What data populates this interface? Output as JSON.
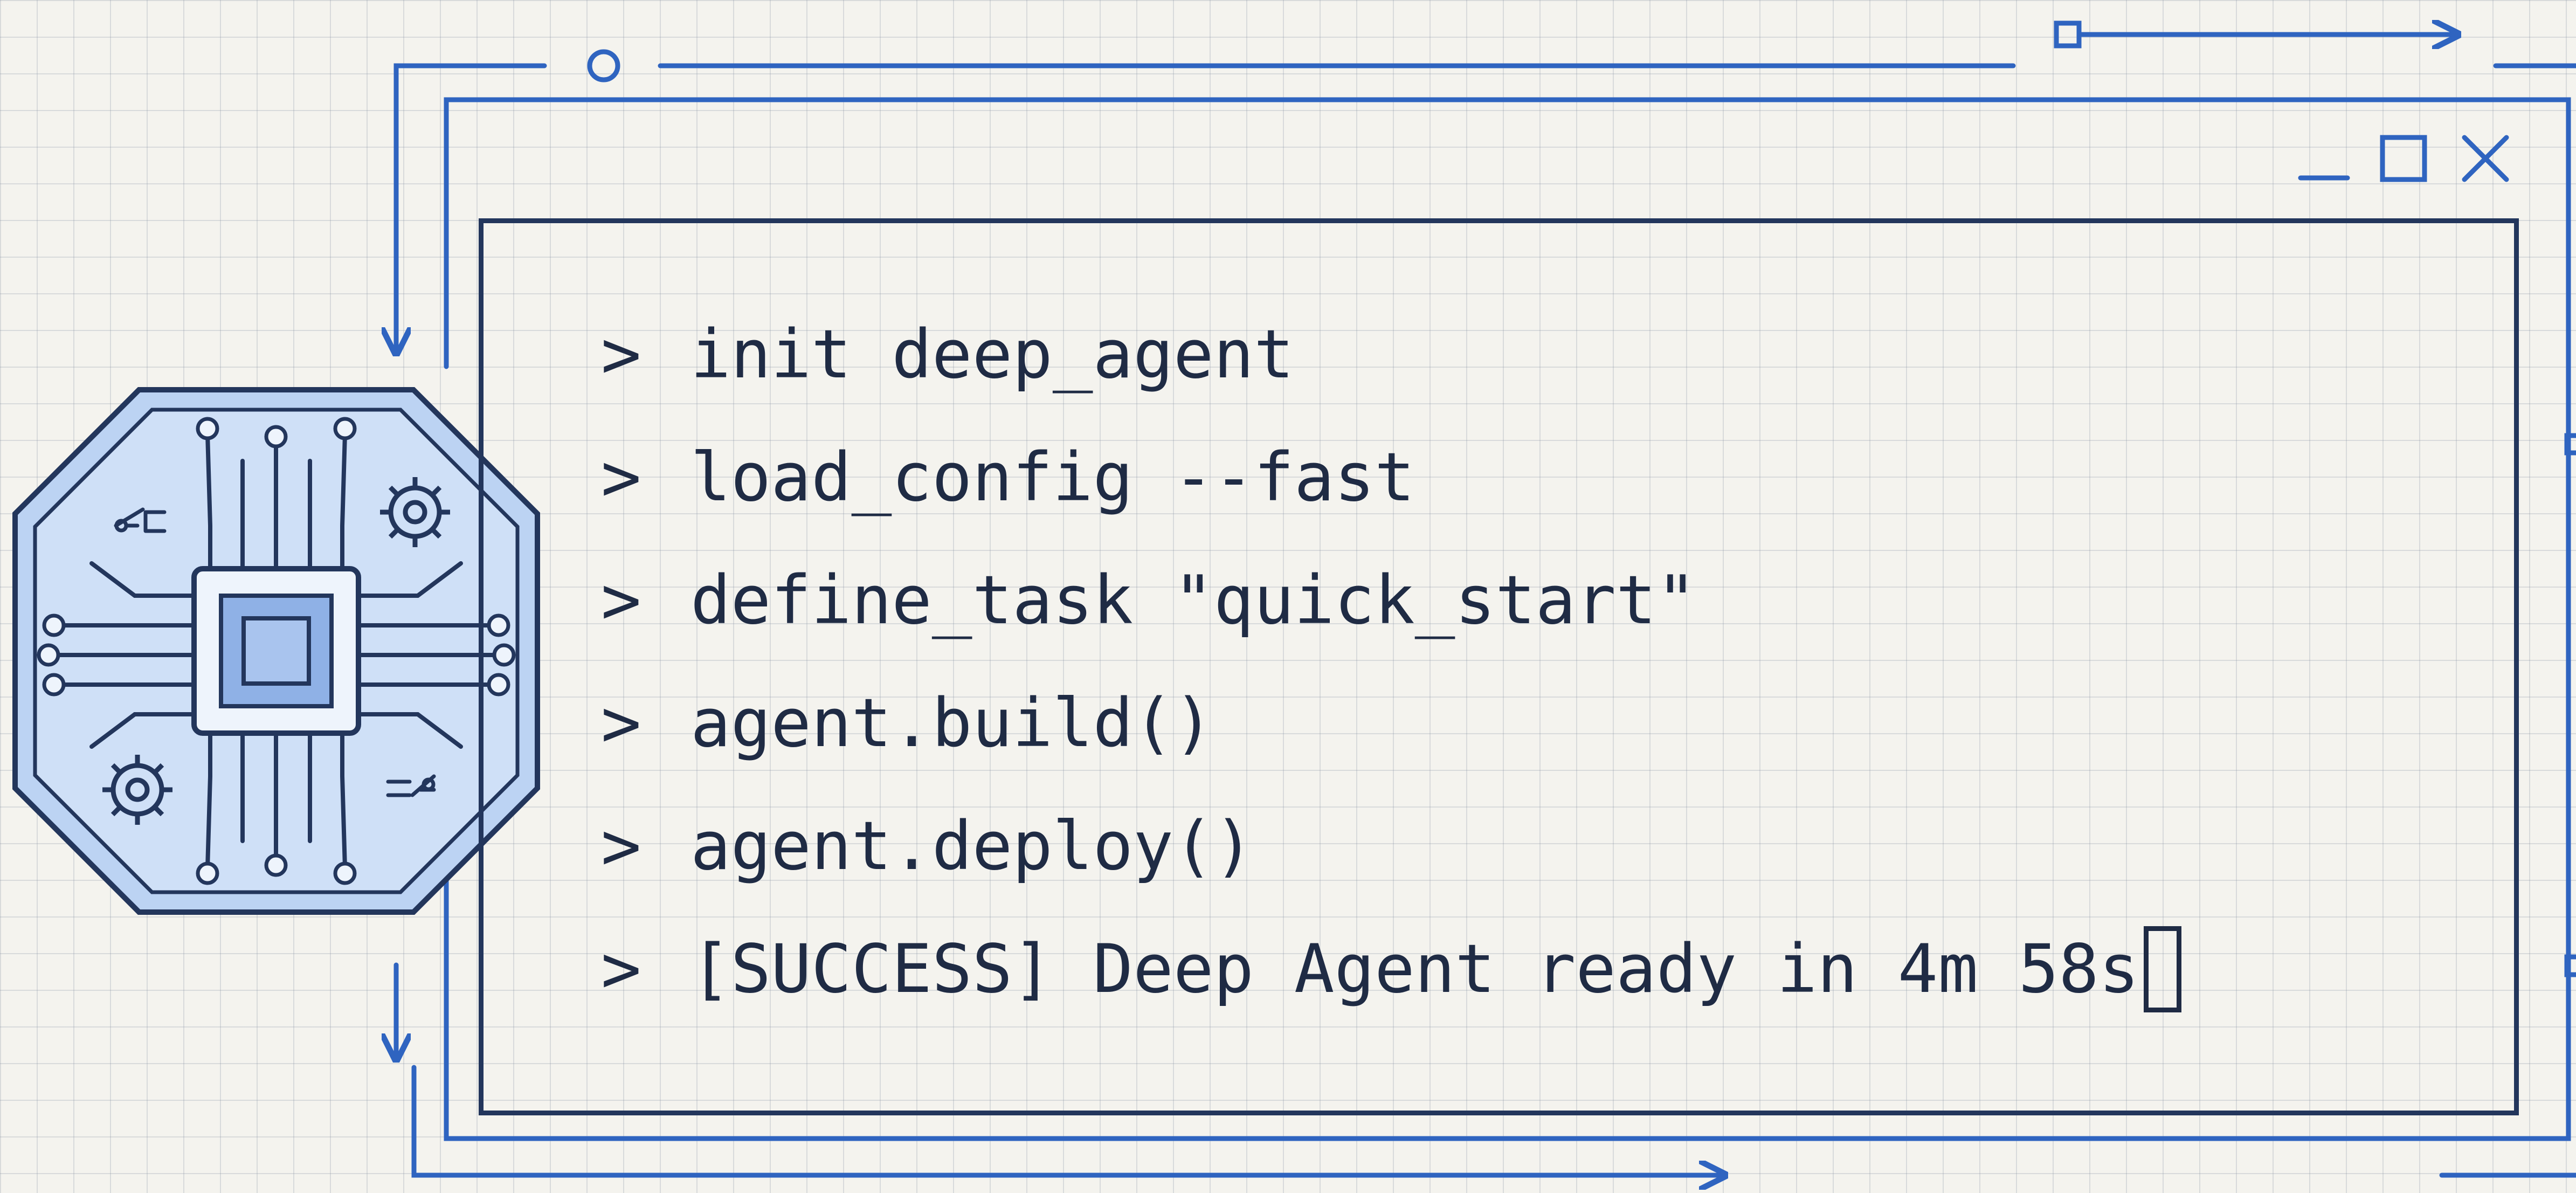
{
  "window": {
    "controls": [
      {
        "name": "minimize",
        "icon": "minimize-icon"
      },
      {
        "name": "maximize",
        "icon": "maximize-icon"
      },
      {
        "name": "close",
        "icon": "close-icon"
      }
    ]
  },
  "terminal": {
    "prompt_symbol": ">",
    "lines": [
      "init deep_agent",
      "load_config --fast",
      "define_task \"quick_start\"",
      "agent.build()",
      "agent.deploy()",
      "[SUCCESS] Deep Agent ready in 4m 58s"
    ],
    "cursor": "block-cursor"
  },
  "illustration": {
    "icon": "ai-chip-icon",
    "sub_icons": [
      "gear-icon",
      "gear-icon",
      "switch-icon",
      "switch-icon"
    ]
  },
  "colors": {
    "accent": "#2f64c0",
    "frame": "#23365c",
    "text": "#1f2b44",
    "chip_fill": "#bcd3f3",
    "background": "#f4f3ee"
  }
}
